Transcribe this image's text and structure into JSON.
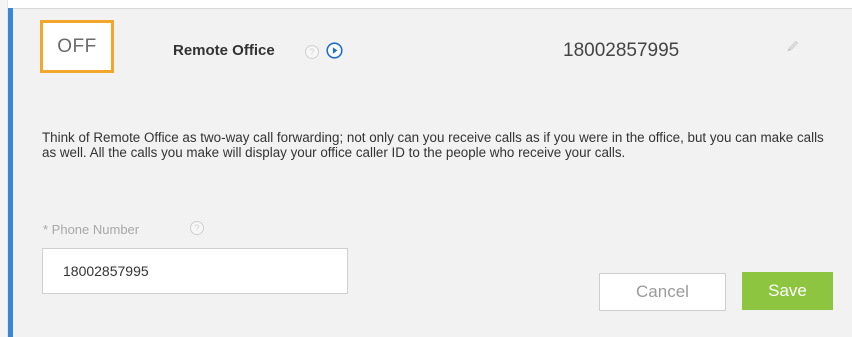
{
  "toggle": {
    "state_label": "OFF",
    "accent_color": "#f2a62a"
  },
  "feature": {
    "title": "Remote Office",
    "help_icon": "question-circle-icon",
    "play_icon": "play-circle-icon",
    "phone_number": "18002857995",
    "edit_icon": "pencil-icon"
  },
  "description": "Think of Remote Office as two-way call forwarding; not only can you receive calls as if you were in the office, but you can make calls as well. All the calls you make will display your office caller ID to the people who receive your calls.",
  "form": {
    "phone_label": "* Phone Number",
    "phone_help_icon": "question-circle-icon",
    "phone_value": "18002857995"
  },
  "actions": {
    "cancel_label": "Cancel",
    "save_label": "Save"
  },
  "colors": {
    "panel_accent": "#3a87d6",
    "save_button": "#8dc541",
    "panel_background": "#f2f2f2"
  }
}
